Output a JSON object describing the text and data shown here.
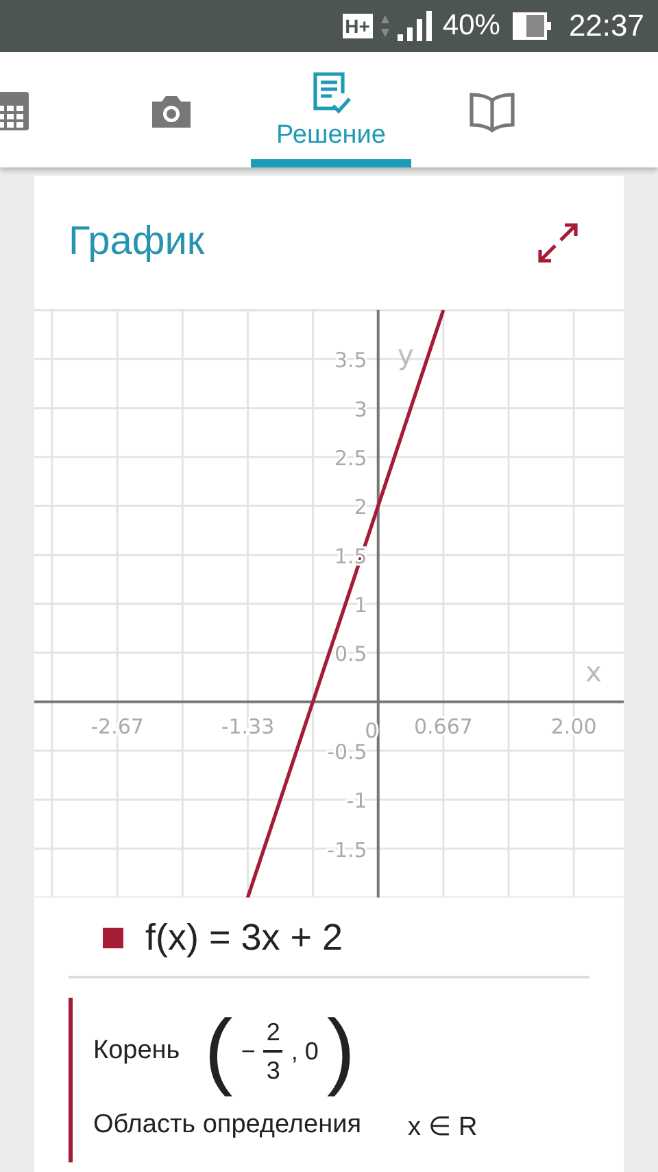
{
  "status_bar": {
    "network": "H+",
    "battery": "40%",
    "time": "22:37"
  },
  "tabs": [
    {
      "kind": "calculator",
      "selected": false
    },
    {
      "kind": "camera",
      "selected": false
    },
    {
      "kind": "solution",
      "label": "Решение",
      "selected": true
    },
    {
      "kind": "book",
      "selected": false
    }
  ],
  "card": {
    "title": "График",
    "chart_data": {
      "type": "line",
      "xlabel": "x",
      "ylabel": "y",
      "xlim": [
        -3.515,
        2.51
      ],
      "ylim": [
        -2,
        4
      ],
      "x": [
        -1.3333,
        0.6667
      ],
      "series": [
        {
          "name": "f(x) = 3x + 2",
          "color": "#a51c37",
          "values": [
            -2,
            4
          ]
        }
      ],
      "xticks": [
        {
          "value": -2.667,
          "label": "-2.67"
        },
        {
          "value": -1.333,
          "label": "-1.33"
        },
        {
          "value": 0,
          "label": "0"
        },
        {
          "value": 0.667,
          "label": "0.667"
        },
        {
          "value": 2,
          "label": "2.00"
        }
      ],
      "grid": true,
      "yticks": [
        {
          "value": -1.5,
          "label": "-1.5"
        },
        {
          "value": -1,
          "label": "-1"
        },
        {
          "value": -0.5,
          "label": "-0.5"
        },
        {
          "value": 0.5,
          "label": "0.5"
        },
        {
          "value": 1,
          "label": "1"
        },
        {
          "value": 1.5,
          "label": "1.5"
        },
        {
          "value": 2,
          "label": "2"
        },
        {
          "value": 2.5,
          "label": "2.5"
        },
        {
          "value": 3,
          "label": "3"
        },
        {
          "value": 3.5,
          "label": "3.5"
        }
      ]
    },
    "root": {
      "label": "Корень",
      "open": "(",
      "sign": "−",
      "numerator": "2",
      "denominator": "3",
      "tail": ", 0",
      "close": ")"
    },
    "domain": {
      "label": "Область определения",
      "value": "x ∈ R"
    }
  }
}
